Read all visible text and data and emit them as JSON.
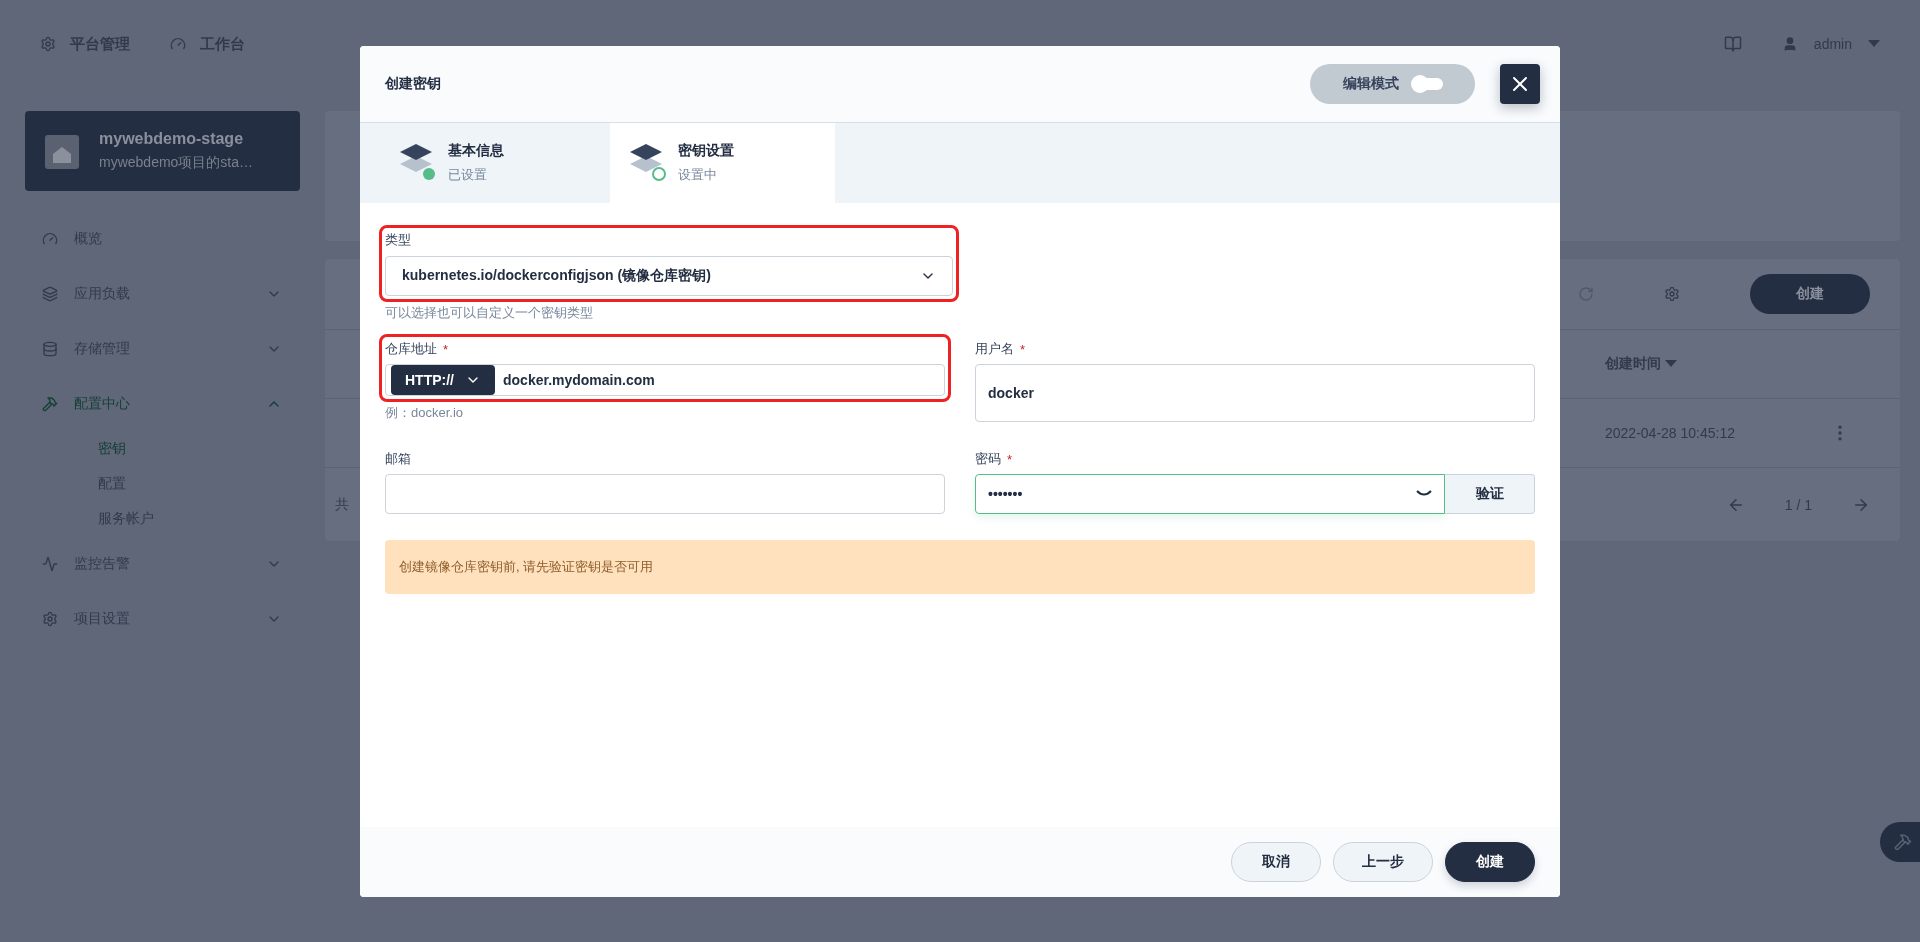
{
  "top_nav": {
    "items": [
      {
        "label": "平台管理"
      },
      {
        "label": "工作台"
      }
    ],
    "user": "admin"
  },
  "project": {
    "name": "mywebdemo-stage",
    "description": "mywebdemo项目的sta…"
  },
  "sidebar": {
    "items": [
      {
        "label": "概览",
        "kind": "link",
        "selected": false
      },
      {
        "label": "应用负载",
        "kind": "group",
        "selected": false,
        "expanded": false
      },
      {
        "label": "存储管理",
        "kind": "group",
        "selected": false,
        "expanded": false
      },
      {
        "label": "配置中心",
        "kind": "group",
        "selected": true,
        "expanded": true,
        "children": [
          {
            "label": "密钥",
            "selected": true
          },
          {
            "label": "配置",
            "selected": false
          },
          {
            "label": "服务帐户",
            "selected": false
          }
        ]
      },
      {
        "label": "监控告警",
        "kind": "group",
        "selected": false,
        "expanded": false
      },
      {
        "label": "项目设置",
        "kind": "group",
        "selected": false,
        "expanded": false
      }
    ]
  },
  "list": {
    "create_button": "创建",
    "column": "创建时间",
    "rows": [
      {
        "created": "2022-04-28 10:45:12"
      }
    ],
    "total": "共",
    "pagination": "1 / 1"
  },
  "dialog": {
    "title": "创建密钥",
    "edit_mode": {
      "label": "编辑模式",
      "on": false
    },
    "steps": [
      {
        "title": "基本信息",
        "status": "已设置",
        "selected": false,
        "done": true
      },
      {
        "title": "密钥设置",
        "status": "设置中",
        "selected": true,
        "done": false
      }
    ],
    "type_field": {
      "label": "类型",
      "value": "kubernetes.io/dockerconfigjson (镜像仓库密钥)",
      "hint": "可以选择也可以自定义一个密钥类型",
      "highlighted": true
    },
    "registry_field": {
      "label": "仓库地址",
      "required_mark": "*",
      "protocol": "HTTP://",
      "value": "docker.mydomain.com",
      "hint": "例：docker.io",
      "highlighted": true
    },
    "username_field": {
      "label": "用户名",
      "required_mark": "*",
      "value": "docker"
    },
    "email_field": {
      "label": "邮箱"
    },
    "password_field": {
      "label": "密码",
      "required_mark": "*",
      "value": "•••••••",
      "focused": true,
      "verify_button": "验证"
    },
    "alert": "创建镜像仓库密钥前, 请先验证密钥是否可用",
    "buttons": [
      {
        "label": "取消",
        "kind": "secondary"
      },
      {
        "label": "上一步",
        "kind": "secondary"
      },
      {
        "label": "创建",
        "kind": "primary"
      }
    ]
  }
}
